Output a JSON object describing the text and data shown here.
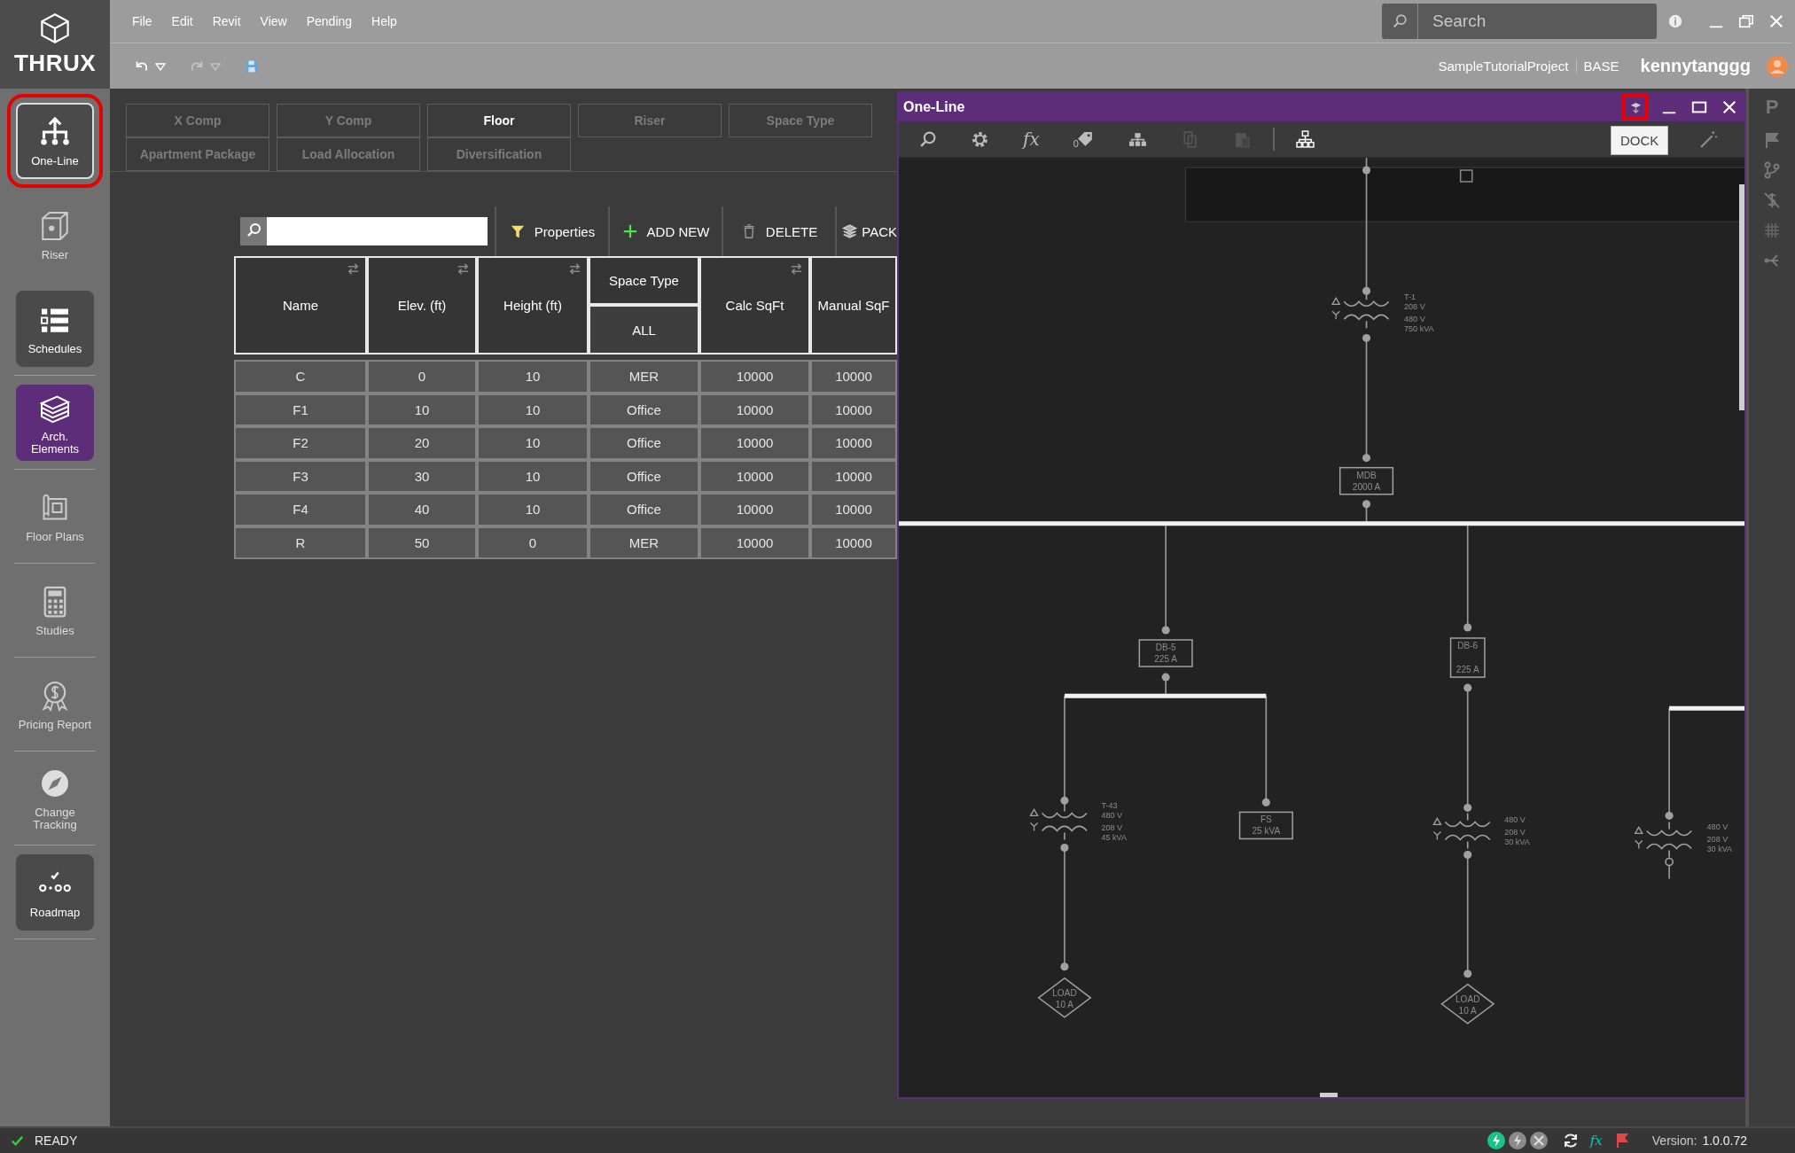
{
  "app": {
    "logo": "THRUX"
  },
  "menu": [
    "File",
    "Edit",
    "Revit",
    "View",
    "Pending",
    "Help"
  ],
  "search": {
    "placeholder": "Search"
  },
  "project": {
    "name": "SampleTutorialProject",
    "branch": "BASE",
    "user": "kennytanggg"
  },
  "sidebar": {
    "items": [
      {
        "label": "One-Line",
        "selected": false,
        "boxed": true,
        "highlighted": true
      },
      {
        "label": "Riser",
        "selected": false,
        "boxed": false,
        "highlighted": false
      },
      {
        "label": "Schedules",
        "selected": false,
        "boxed": true,
        "highlighted": false
      },
      {
        "label": "Arch. Elements",
        "selected": true,
        "boxed": false,
        "highlighted": false
      },
      {
        "label": "Floor Plans",
        "selected": false,
        "boxed": false,
        "highlighted": false
      },
      {
        "label": "Studies",
        "selected": false,
        "boxed": false,
        "highlighted": false
      },
      {
        "label": "Pricing Report",
        "selected": false,
        "boxed": false,
        "highlighted": false
      },
      {
        "label": "Change Tracking",
        "selected": false,
        "boxed": false,
        "highlighted": false
      },
      {
        "label": "Roadmap",
        "selected": false,
        "boxed": true,
        "highlighted": false
      }
    ]
  },
  "tab_rows": [
    {
      "tabs": [
        {
          "label": "X Comp",
          "selected": false
        },
        {
          "label": "Y Comp",
          "selected": false
        },
        {
          "label": "Floor",
          "selected": true
        },
        {
          "label": "Riser",
          "selected": false
        },
        {
          "label": "Space Type",
          "selected": false
        }
      ]
    },
    {
      "tabs": [
        {
          "label": "Apartment Package",
          "selected": false
        },
        {
          "label": "Load Allocation",
          "selected": false
        },
        {
          "label": "Diversification",
          "selected": false
        }
      ]
    }
  ],
  "grid_buttons": [
    {
      "label": "Properties",
      "kind": "filter"
    },
    {
      "label": "ADD NEW",
      "kind": "add"
    },
    {
      "label": "DELETE",
      "kind": "delete"
    },
    {
      "label": "PACK",
      "kind": "package"
    }
  ],
  "table": {
    "columns": [
      {
        "label": "Name",
        "sortable": true
      },
      {
        "label": "Elev. (ft)",
        "sortable": true
      },
      {
        "label": "Height (ft)",
        "sortable": true
      },
      {
        "label": "Space Type",
        "sortable": false,
        "filter": "ALL"
      },
      {
        "label": "Calc SqFt",
        "sortable": true
      },
      {
        "label": "Manual SqF",
        "sortable": false
      }
    ],
    "rows": [
      [
        "C",
        "0",
        "10",
        "MER",
        "10000",
        "10000"
      ],
      [
        "F1",
        "10",
        "10",
        "Office",
        "10000",
        "10000"
      ],
      [
        "F2",
        "20",
        "10",
        "Office",
        "10000",
        "10000"
      ],
      [
        "F3",
        "30",
        "10",
        "Office",
        "10000",
        "10000"
      ],
      [
        "F4",
        "40",
        "10",
        "Office",
        "10000",
        "10000"
      ],
      [
        "R",
        "50",
        "0",
        "MER",
        "10000",
        "10000"
      ]
    ]
  },
  "one_line_window": {
    "title": "One-Line",
    "tag_count": "0",
    "fx": "fx",
    "tooltip": "DOCK",
    "dock_highlighted": true,
    "diagram": {
      "group_box": {
        "checked": false
      },
      "nodes": [
        {
          "kind": "transformer",
          "lines": [
            "T-1",
            "208 V",
            "480 V",
            "750 kVA"
          ]
        },
        {
          "kind": "panel",
          "lines": [
            "MDB",
            "2000 A"
          ]
        },
        {
          "kind": "panel",
          "lines": [
            "DB-5",
            "225 A"
          ]
        },
        {
          "kind": "panel",
          "lines": [
            "DB-6",
            "225 A"
          ]
        },
        {
          "kind": "transformer",
          "lines": [
            "T-43",
            "480 V",
            "208 V",
            "45 kVA"
          ]
        },
        {
          "kind": "panel",
          "lines": [
            "FS",
            "25 kVA"
          ]
        },
        {
          "kind": "transformer",
          "lines": [
            "480 V",
            "208 V",
            "30 kVA"
          ]
        },
        {
          "kind": "transformer",
          "lines": [
            "480 V",
            "208 V",
            "30 kVA"
          ]
        },
        {
          "kind": "load",
          "lines": [
            "LOAD",
            "10 A"
          ]
        },
        {
          "kind": "load",
          "lines": [
            "LOAD",
            "10 A"
          ]
        }
      ]
    }
  },
  "right_rail": {
    "letter": "P"
  },
  "status_bar": {
    "status": "READY",
    "fx": "fx",
    "version_label": "Version:",
    "version": "1.0.0.72"
  }
}
